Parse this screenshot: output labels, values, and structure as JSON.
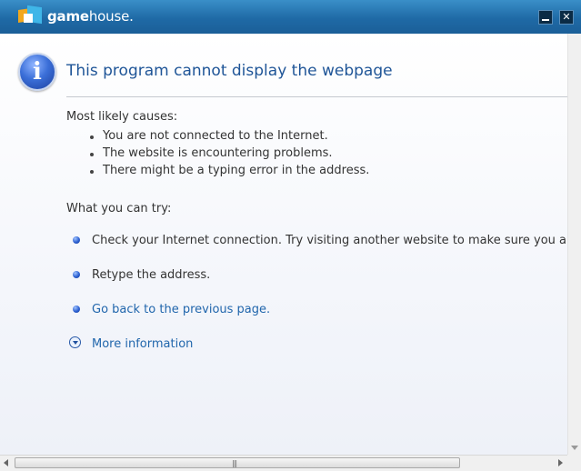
{
  "app": {
    "logo_bold": "game",
    "logo_light": "house.",
    "minimize_label": "",
    "close_label": "✕"
  },
  "page": {
    "title": "This program cannot display the webpage",
    "causes_heading": "Most likely causes:",
    "causes": [
      "You are not connected to the Internet.",
      "The website is encountering problems.",
      "There might be a typing error in the address."
    ],
    "try_heading": "What you can try:",
    "try_items": [
      "Check your Internet connection. Try visiting another website to make sure you are connected.",
      "Retype the address.",
      "Go back to the previous page."
    ],
    "more_info": "More information"
  },
  "colors": {
    "title_blue": "#1f5597",
    "link_blue": "#2166ac",
    "titlebar": "#1f6aa6"
  },
  "icons": {
    "info": "info-icon",
    "expand": "chevron-down-circle-icon"
  }
}
